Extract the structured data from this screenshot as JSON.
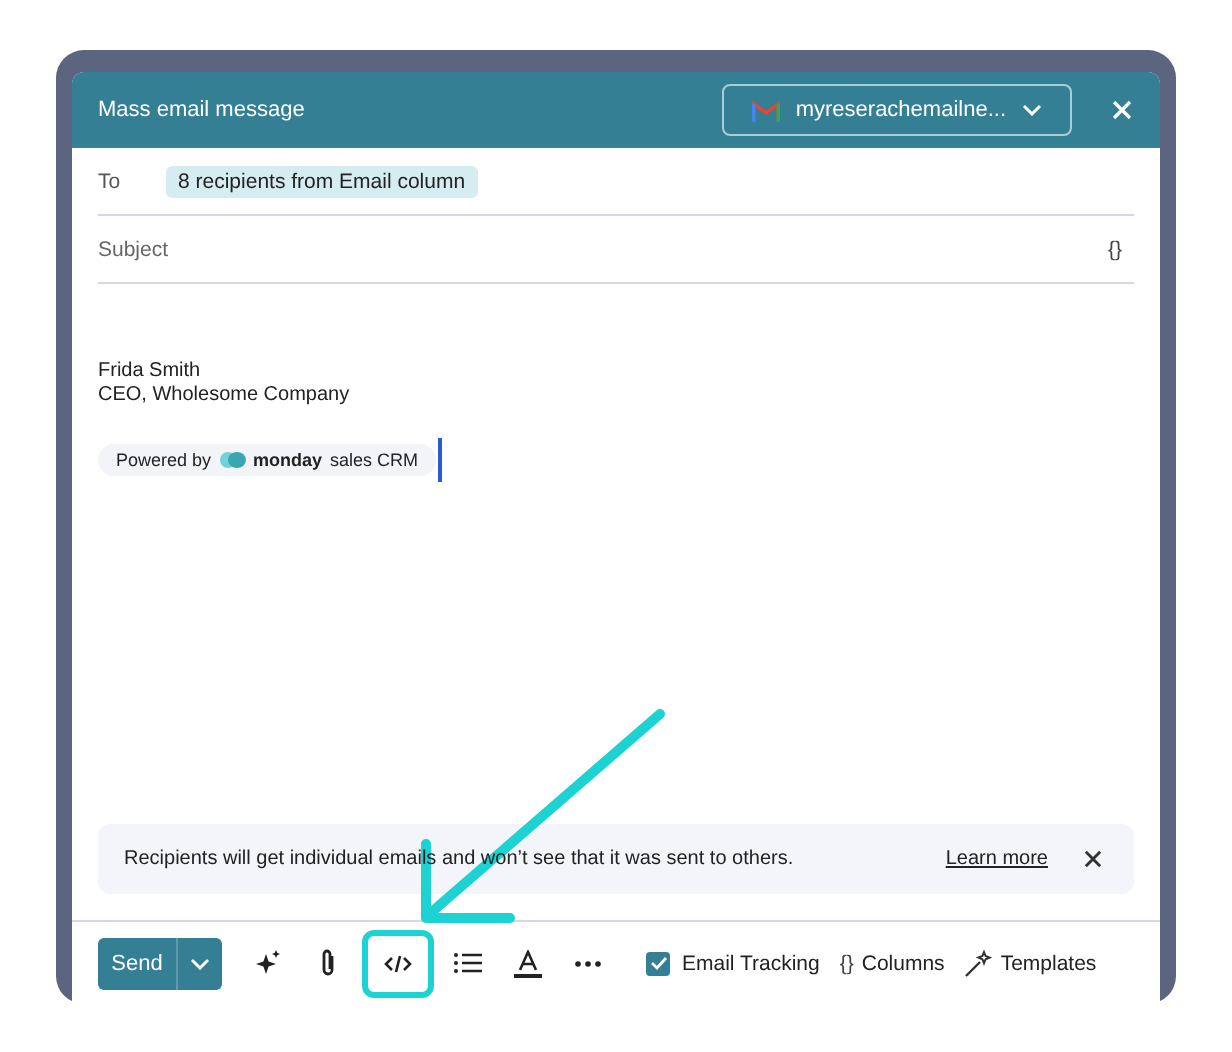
{
  "window": {
    "title": "Mass email message"
  },
  "sender": {
    "account": "myreserachemailne..."
  },
  "to": {
    "label": "To",
    "chip": "8 recipients from Email column"
  },
  "subject": {
    "placeholder": "Subject",
    "variables_glyph": "{}"
  },
  "signature": [
    "Frida Smith",
    "CEO, Wholesome Company"
  ],
  "powered_by": {
    "prefix": "Powered by",
    "brand": "monday",
    "suffix": "sales CRM"
  },
  "banner": {
    "text": "Recipients will get individual emails and won’t see that it was sent to others.",
    "link": "Learn more"
  },
  "toolbar": {
    "send": "Send",
    "email_tracking": {
      "label": "Email Tracking",
      "checked": true
    },
    "columns": {
      "glyph": "{}",
      "label": "Columns"
    },
    "templates": "Templates",
    "tools": [
      {
        "kind": "ai",
        "highlighted": false
      },
      {
        "kind": "attach",
        "highlighted": false
      },
      {
        "kind": "code",
        "highlighted": true
      },
      {
        "kind": "list",
        "highlighted": false
      },
      {
        "kind": "textcolor",
        "highlighted": false
      },
      {
        "kind": "more",
        "highlighted": false
      }
    ]
  }
}
